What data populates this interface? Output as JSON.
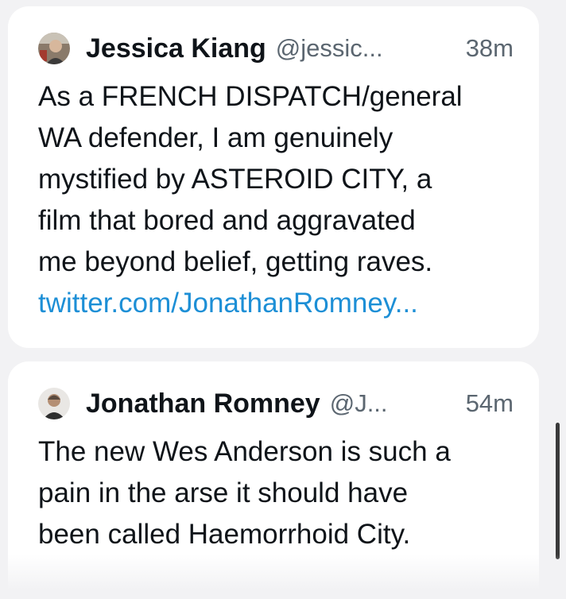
{
  "tweets": [
    {
      "name": "Jessica Kiang",
      "handle": "@jessic...",
      "time": "38m",
      "lines": [
        "As a FRENCH DISPATCH/general",
        "WA defender, I am genuinely",
        "mystified by ASTEROID CITY, a",
        "film that bored and aggravated",
        "me beyond belief, getting raves."
      ],
      "link": "twitter.com/JonathanRomney..."
    },
    {
      "name": "Jonathan Romney",
      "handle": "@J...",
      "time": "54m",
      "lines": [
        "The new Wes Anderson is such a",
        "pain in the arse it should have",
        "been called Haemorrhoid City."
      ]
    }
  ]
}
